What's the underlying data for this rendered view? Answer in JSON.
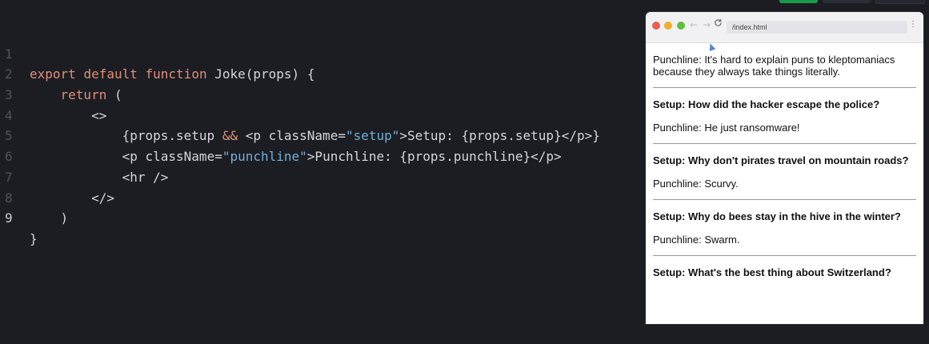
{
  "editor": {
    "lines": [
      {
        "num": "1"
      },
      {
        "num": "2"
      },
      {
        "num": "3"
      },
      {
        "num": "4"
      },
      {
        "num": "5"
      },
      {
        "num": "6"
      },
      {
        "num": "7"
      },
      {
        "num": "8"
      },
      {
        "num": "9"
      }
    ],
    "tokens": {
      "export": "export",
      "default": "default",
      "function": "function",
      "fn_name": "Joke(props) {",
      "return": "return",
      "paren_open": " (",
      "frag_open": "<>",
      "l4_a": "{props.setup ",
      "l4_and": "&&",
      "l4_b": " <p ",
      "l4_attr": "className=",
      "l4_str": "\"setup\"",
      "l4_c": ">Setup: {props.setup}</p>}",
      "l5_a": "<p ",
      "l5_attr": "className=",
      "l5_str": "\"punchline\"",
      "l5_c": ">Punchline: {props.punchline}</p>",
      "l6": "<hr />",
      "frag_close": "</>",
      "paren_close": ")",
      "brace_close": "}"
    }
  },
  "browser": {
    "url": "/index.html",
    "nav_back": "←",
    "nav_forward": "→",
    "reload": "C",
    "menu": "⋮"
  },
  "jokes": [
    {
      "setup": "",
      "punchline": "Punchline: It's hard to explain puns to kleptomaniacs because they always take things literally."
    },
    {
      "setup": "Setup: How did the hacker escape the police?",
      "punchline": "Punchline: He just ransomware!"
    },
    {
      "setup": "Setup: Why don't pirates travel on mountain roads?",
      "punchline": "Punchline: Scurvy."
    },
    {
      "setup": "Setup: Why do bees stay in the hive in the winter?",
      "punchline": "Punchline: Swarm."
    },
    {
      "setup": "Setup: What's the best thing about Switzerland?",
      "punchline": ""
    }
  ]
}
